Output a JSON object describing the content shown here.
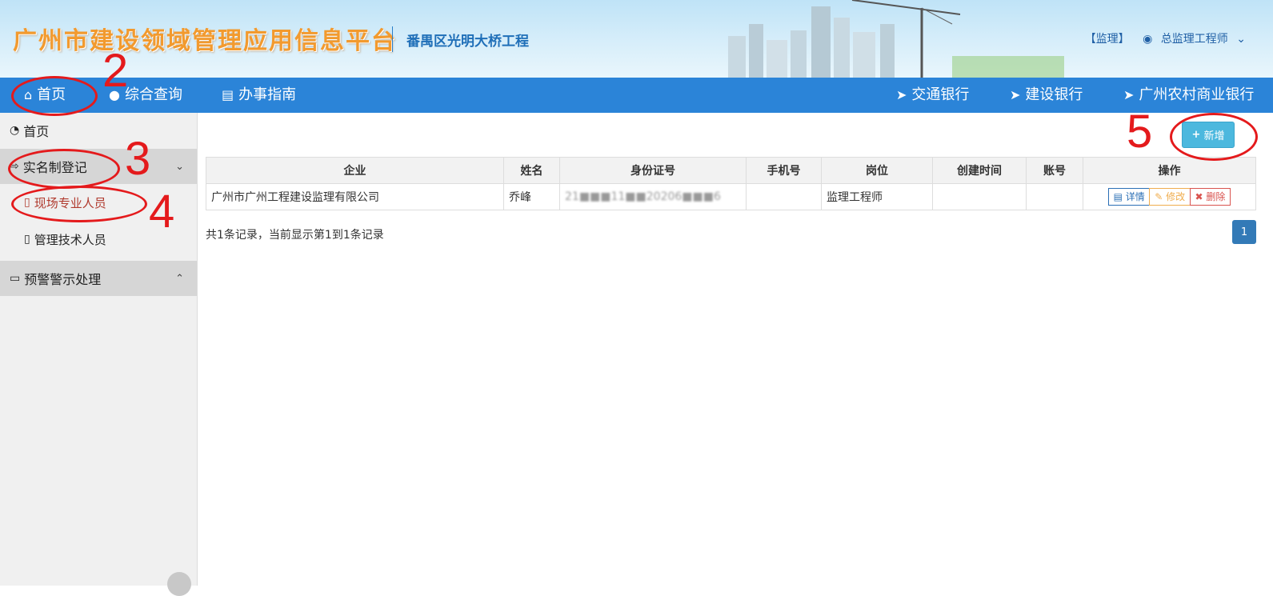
{
  "header": {
    "title": "广州市建设领域管理应用信息平台",
    "project": "番禺区光明大桥工程",
    "role": "【监理】",
    "user": "总监理工程师"
  },
  "nav": {
    "home": "首页",
    "query": "综合查询",
    "guide": "办事指南",
    "bank1": "交通银行",
    "bank2": "建设银行",
    "bank3": "广州农村商业银行"
  },
  "sidebar": {
    "home": "首页",
    "group1": "实名制登记",
    "item1": "现场专业人员",
    "item2": "管理技术人员",
    "group2": "预警警示处理"
  },
  "toolbar": {
    "add_label": "新增"
  },
  "table": {
    "headers": [
      "企业",
      "姓名",
      "身份证号",
      "手机号",
      "岗位",
      "创建时间",
      "账号",
      "操作"
    ],
    "rows": [
      {
        "company": "广州市广州工程建设监理有限公司",
        "name": "乔峰",
        "id_number": "21■■■11■■20206■■■6",
        "phone": "",
        "position": "监理工程师",
        "created": "",
        "account": ""
      }
    ],
    "actions": {
      "detail": "详情",
      "edit": "修改",
      "delete": "删除"
    }
  },
  "pagination": {
    "summary": "共1条记录，当前显示第1到1条记录",
    "page": "1"
  },
  "annotations": [
    "2",
    "3",
    "4",
    "5"
  ],
  "colors": {
    "nav": "#2b84d8",
    "annotation": "#e41a1c",
    "add_button": "#4cb8de"
  }
}
